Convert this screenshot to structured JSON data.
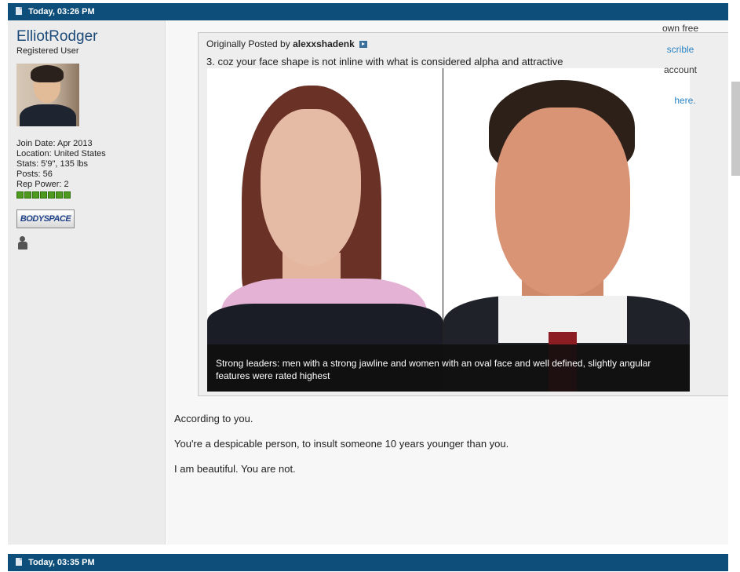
{
  "posts": [
    {
      "date": "Today, 03:26 PM"
    },
    {
      "date": "Today, 03:35 PM"
    }
  ],
  "user": {
    "name": "ElliotRodger",
    "title": "Registered User",
    "join_date": "Join Date: Apr 2013",
    "location": "Location: United States",
    "stats": "Stats: 5'9\", 135 lbs",
    "posts": "Posts: 56",
    "rep_power": "Rep Power: 2",
    "bodyspace_label": "BODYSPACE",
    "avatar": "user-avatar-photo"
  },
  "quote": {
    "prefix": "Originally Posted by",
    "author": "alexxshadenk",
    "text": "3. coz your face shape is not inline with what is considered alpha and attractive",
    "caption": "Strong leaders: men with a strong jawline and women with an oval face and well defined, slightly angular features were rated highest"
  },
  "message": [
    "According to you.",
    "You're a despicable person, to insult someone 10 years younger than you.",
    "I am beautiful. You are not."
  ],
  "side_ad": [
    {
      "text": "own free",
      "style": "dark"
    },
    {
      "text": "scrible",
      "style": "link"
    },
    {
      "text": "account",
      "style": "dark"
    },
    {
      "text": "here.",
      "style": "link"
    }
  ],
  "colors": {
    "header_bar": "#0d4f7a",
    "username": "#1b4a79",
    "link": "#2b84c5",
    "rep_green": "#4d9a1f"
  }
}
